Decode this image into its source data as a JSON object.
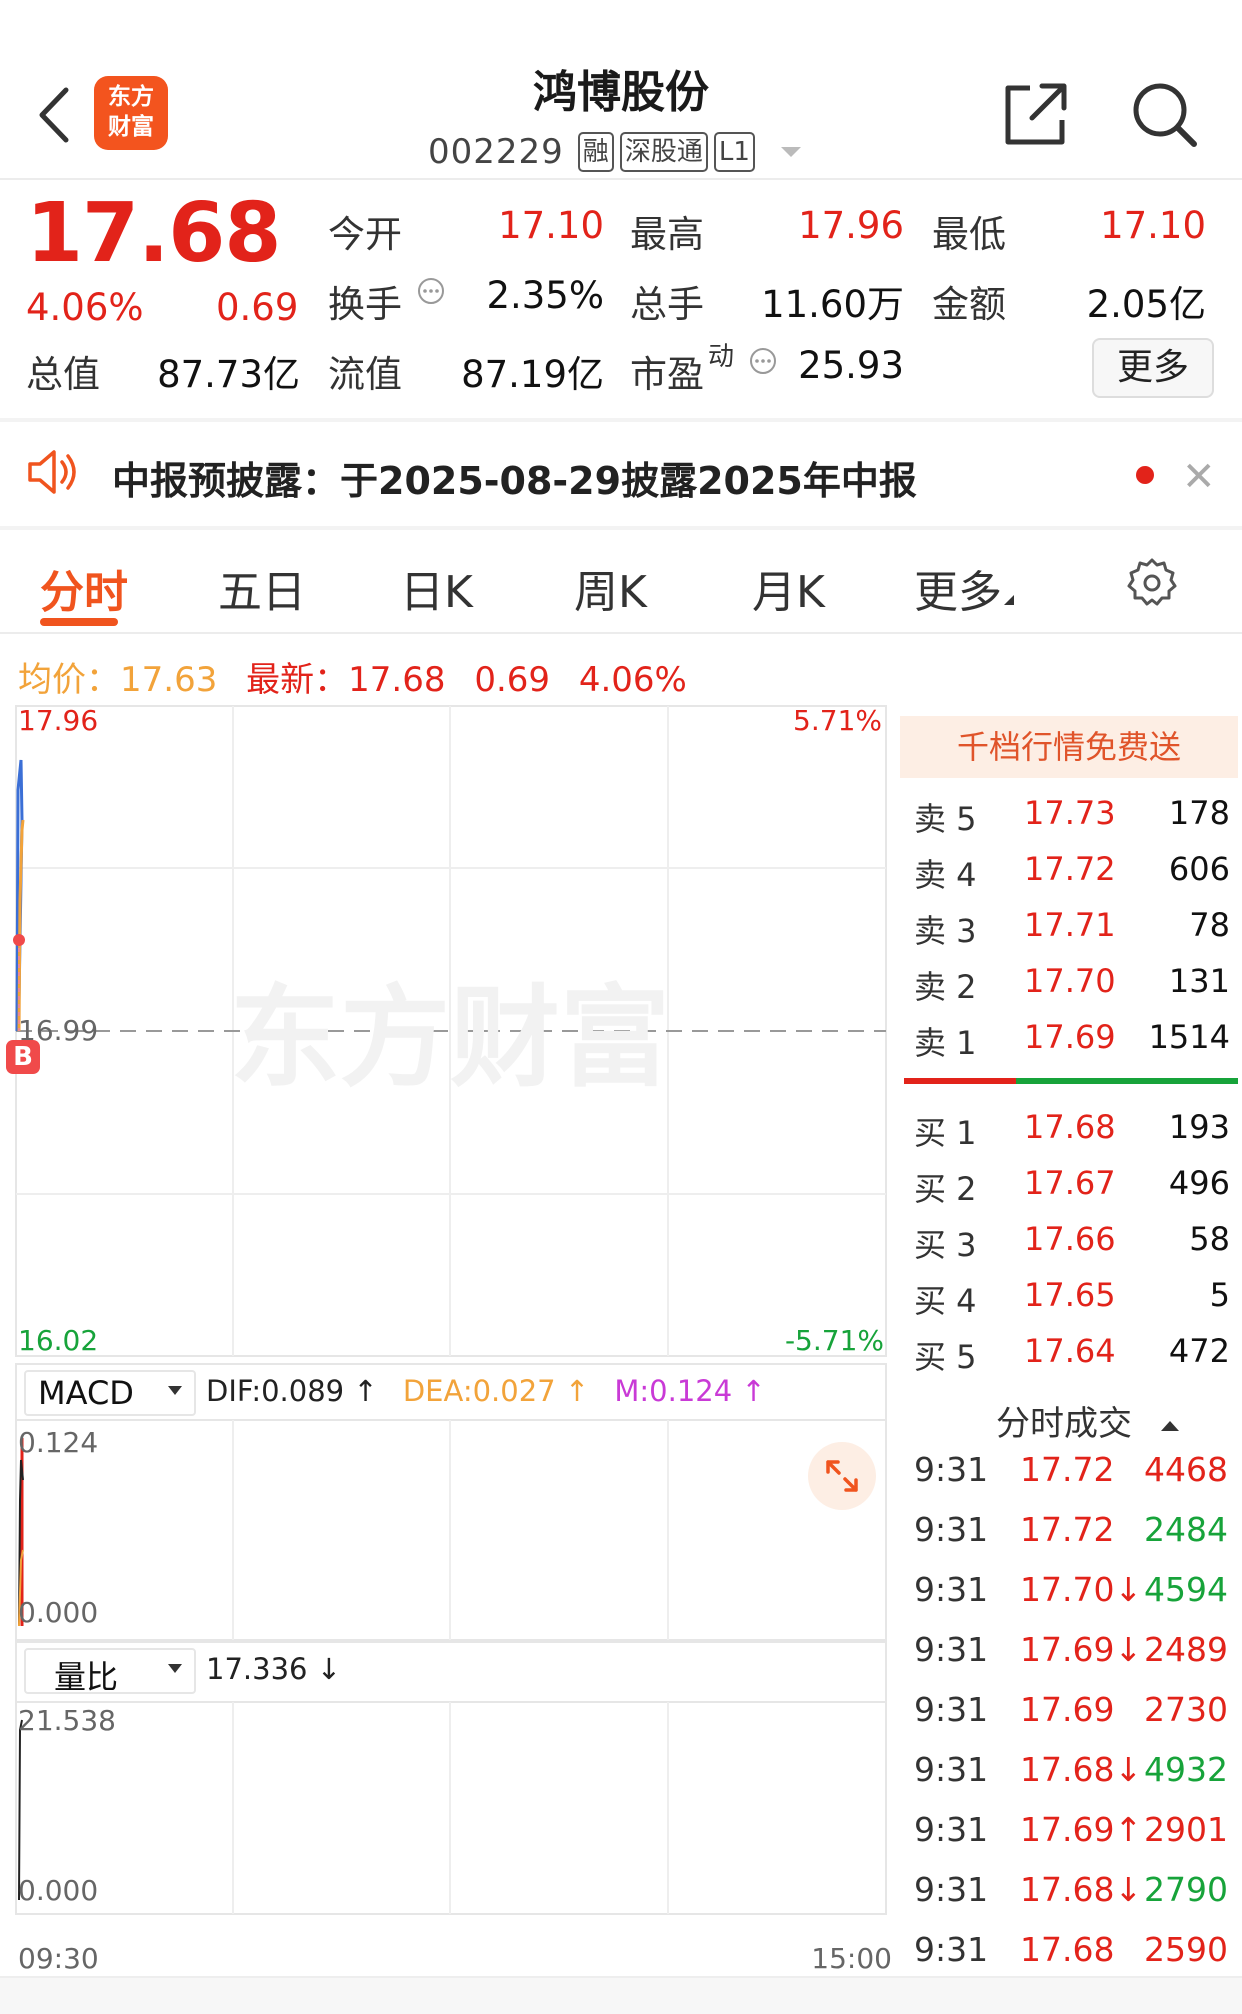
{
  "header": {
    "logo_line1": "东方",
    "logo_line2": "财富",
    "stock_name": "鸿博股份",
    "stock_code": "002229",
    "tags": [
      "融",
      "深股通",
      "L1"
    ]
  },
  "quote": {
    "price": "17.68",
    "change_pct": "4.06%",
    "change": "0.69",
    "fields": {
      "open": {
        "label": "今开",
        "value": "17.10"
      },
      "high": {
        "label": "最高",
        "value": "17.96"
      },
      "low": {
        "label": "最低",
        "value": "17.10"
      },
      "turnover_rate": {
        "label": "换手",
        "value": "2.35%"
      },
      "volume": {
        "label": "总手",
        "value": "11.60万"
      },
      "amount": {
        "label": "金额",
        "value": "2.05亿"
      },
      "market_cap": {
        "label": "总值",
        "value": "87.73亿"
      },
      "float_cap": {
        "label": "流值",
        "value": "87.19亿"
      },
      "pe": {
        "label": "市盈",
        "sup": "动",
        "value": "25.93"
      }
    },
    "more_label": "更多"
  },
  "notice": {
    "text": "中报预披露：于2025-08-29披露2025年中报"
  },
  "tabs": [
    {
      "label": "分时",
      "active": true
    },
    {
      "label": "五日",
      "active": false
    },
    {
      "label": "日K",
      "active": false
    },
    {
      "label": "周K",
      "active": false
    },
    {
      "label": "月K",
      "active": false
    },
    {
      "label": "更多",
      "active": false
    }
  ],
  "info_line": {
    "avg_label": "均价：",
    "avg_value": "17.63",
    "latest_label": "最新：",
    "latest_value": "17.68",
    "change": "0.69",
    "change_pct": "4.06%"
  },
  "intraday_chart": {
    "y_top": "17.96",
    "y_mid": "16.99",
    "y_bottom": "16.02",
    "pct_top": "5.71%",
    "pct_bottom": "-5.71%",
    "watermark": "东方财富",
    "marker": "B",
    "time_start": "09:30",
    "time_end": "15:00"
  },
  "macd": {
    "selector": "MACD",
    "dif": "DIF:0.089 ↑",
    "dea": "DEA:0.027 ↑",
    "m": "M:0.124 ↑",
    "y_top": "0.124",
    "y_bottom": "0.000"
  },
  "volume_ratio": {
    "selector": "量比",
    "value": "17.336 ↓",
    "y_top": "21.538",
    "y_bottom": "0.000"
  },
  "order_book": {
    "header": "千档行情免费送",
    "asks": [
      {
        "label": "卖 5",
        "price": "17.73",
        "volume": "178"
      },
      {
        "label": "卖 4",
        "price": "17.72",
        "volume": "606"
      },
      {
        "label": "卖 3",
        "price": "17.71",
        "volume": "78"
      },
      {
        "label": "卖 2",
        "price": "17.70",
        "volume": "131"
      },
      {
        "label": "卖 1",
        "price": "17.69",
        "volume": "1514"
      }
    ],
    "bids": [
      {
        "label": "买 1",
        "price": "17.68",
        "volume": "193"
      },
      {
        "label": "买 2",
        "price": "17.67",
        "volume": "496"
      },
      {
        "label": "买 3",
        "price": "17.66",
        "volume": "58"
      },
      {
        "label": "买 4",
        "price": "17.65",
        "volume": "5"
      },
      {
        "label": "买 5",
        "price": "17.64",
        "volume": "472"
      }
    ]
  },
  "ticks": {
    "title": "分时成交",
    "rows": [
      {
        "time": "9:31",
        "price": "17.72",
        "volume": "4468",
        "dir": "buy"
      },
      {
        "time": "9:31",
        "price": "17.72",
        "volume": "2484",
        "dir": "sell"
      },
      {
        "time": "9:31",
        "price": "17.70↓",
        "volume": "4594",
        "dir": "sell"
      },
      {
        "time": "9:31",
        "price": "17.69↓",
        "volume": "2489",
        "dir": "buy"
      },
      {
        "time": "9:31",
        "price": "17.69",
        "volume": "2730",
        "dir": "buy"
      },
      {
        "time": "9:31",
        "price": "17.68↓",
        "volume": "4932",
        "dir": "sell"
      },
      {
        "time": "9:31",
        "price": "17.69↑",
        "volume": "2901",
        "dir": "buy"
      },
      {
        "time": "9:31",
        "price": "17.68↓",
        "volume": "2790",
        "dir": "sell"
      },
      {
        "time": "9:31",
        "price": "17.68",
        "volume": "2590",
        "dir": "buy"
      }
    ]
  },
  "colors": {
    "up": "#e2231a",
    "down": "#17a33a",
    "accent": "#f0541e",
    "avg_line": "#f2a33a",
    "price_line": "#3b6fd6"
  }
}
